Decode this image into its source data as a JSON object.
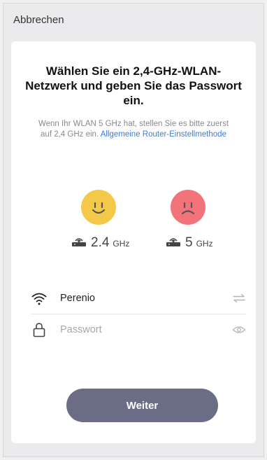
{
  "topbar": {
    "cancel_label": "Abbrechen"
  },
  "heading": "Wählen Sie ein 2,4-GHz-WLAN-Netzwerk und geben Sie das Passwort ein.",
  "hint": {
    "text": "Wenn Ihr WLAN 5 GHz hat, stellen Sie es bitte zuerst auf 2,4 GHz ein.",
    "link": "Allgemeine Router-Einstellmethode"
  },
  "bands": [
    {
      "icon": "smiley-face-icon",
      "number": "2.4",
      "unit": "GHz",
      "face_color": "#f4c94a"
    },
    {
      "icon": "frowning-face-icon",
      "number": "5",
      "unit": "GHz",
      "face_color": "#f2737a"
    }
  ],
  "wifi": {
    "ssid": "Perenio",
    "icon": "wifi-icon",
    "switch_icon": "switch-network-icon"
  },
  "password": {
    "placeholder": "Passwort",
    "value": "",
    "icon": "lock-icon",
    "toggle_icon": "eye-icon"
  },
  "next_button": {
    "label": "Weiter",
    "color": "#6b6d86"
  },
  "accent_link_color": "#3d7ae0"
}
